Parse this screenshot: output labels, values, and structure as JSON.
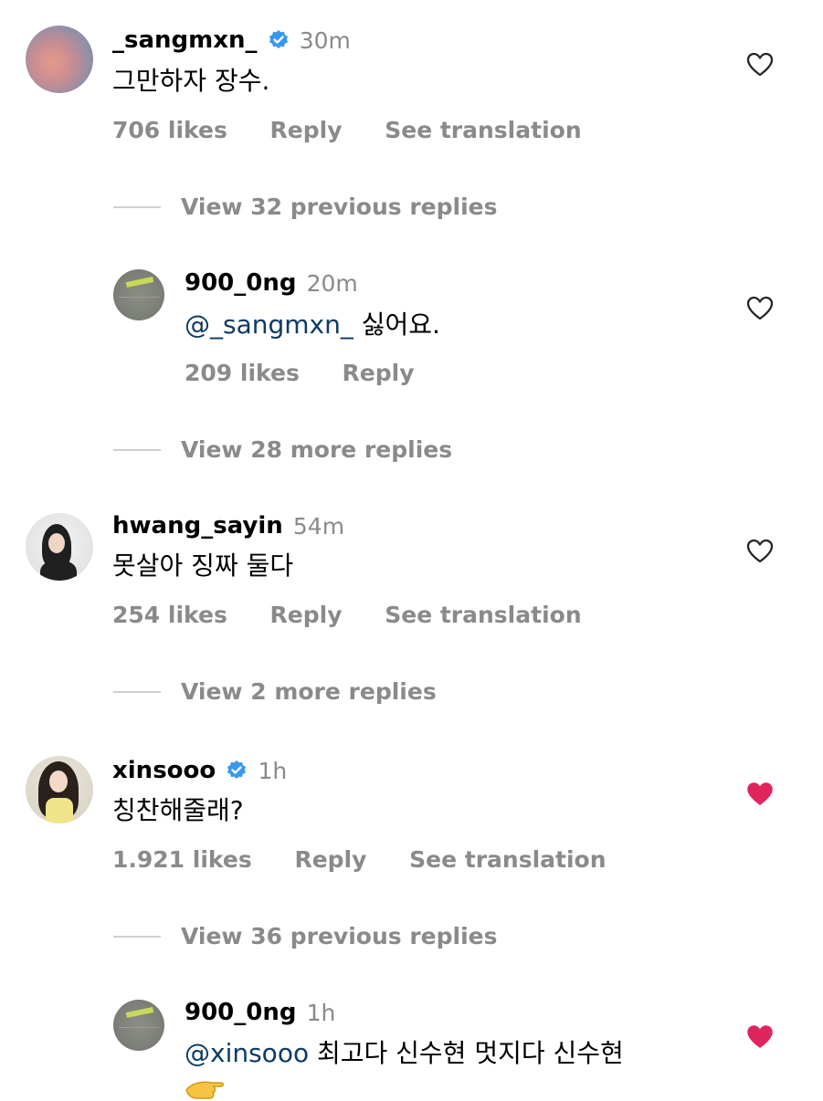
{
  "comments": [
    {
      "username": "_sangmxn_",
      "verified": true,
      "time": "30m",
      "text": "그만하자 장수.",
      "likes": "706 likes",
      "reply": "Reply",
      "translate": "See translation",
      "liked": false,
      "avatar_icon": "sky-avatar",
      "view_replies": "View 32 previous replies"
    },
    {
      "username": "900_0ng",
      "verified": false,
      "time": "20m",
      "mention": "@_sangmxn_",
      "text": " 싫어요.",
      "likes": "209 likes",
      "reply": "Reply",
      "liked": false,
      "avatar_icon": "vinyl-avatar",
      "view_replies": "View 28 more replies"
    },
    {
      "username": "hwang_sayin",
      "verified": false,
      "time": "54m",
      "text": "못살아 징짜 둘다",
      "likes": "254 likes",
      "reply": "Reply",
      "translate": "See translation",
      "liked": false,
      "avatar_icon": "person-avatar",
      "view_replies": "View 2 more replies"
    },
    {
      "username": "xinsooo",
      "verified": true,
      "time": "1h",
      "text": "칭찬해줄래?",
      "likes": "1.921 likes",
      "reply": "Reply",
      "translate": "See translation",
      "liked": true,
      "avatar_icon": "girl-avatar",
      "view_replies": "View 36 previous replies"
    },
    {
      "username": "900_0ng",
      "verified": false,
      "time": "1h",
      "mention": "@xinsooo",
      "text": " 최고다 신수현 멋지다 신수현",
      "emoji": "pointing-hand-emoji",
      "liked": true,
      "avatar_icon": "vinyl-avatar"
    }
  ],
  "colors": {
    "muted": "#8a8a8a",
    "mention": "#0d3b66",
    "verified": "#3897f0",
    "heart_liked": "#e0245e",
    "heart_outline": "#262626"
  }
}
